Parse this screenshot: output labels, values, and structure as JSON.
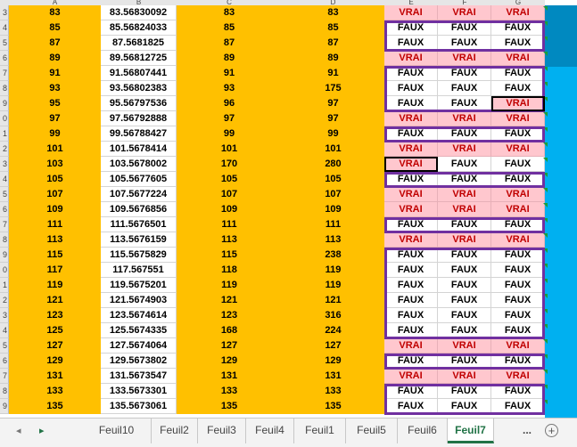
{
  "columns": [
    "A",
    "B",
    "C",
    "D",
    "E",
    "F",
    "G"
  ],
  "rows": [
    {
      "num": "3",
      "a": "83",
      "b": "83.56830092",
      "c": "83",
      "d": "83",
      "e": "VRAI",
      "f": "VRAI",
      "g": "VRAI"
    },
    {
      "num": "4",
      "a": "85",
      "b": "85.56824033",
      "c": "85",
      "d": "85",
      "e": "FAUX",
      "f": "FAUX",
      "g": "FAUX"
    },
    {
      "num": "5",
      "a": "87",
      "b": "87.5681825",
      "c": "87",
      "d": "87",
      "e": "FAUX",
      "f": "FAUX",
      "g": "FAUX"
    },
    {
      "num": "6",
      "a": "89",
      "b": "89.56812725",
      "c": "89",
      "d": "89",
      "e": "VRAI",
      "f": "VRAI",
      "g": "VRAI"
    },
    {
      "num": "7",
      "a": "91",
      "b": "91.56807441",
      "c": "91",
      "d": "91",
      "e": "FAUX",
      "f": "FAUX",
      "g": "FAUX"
    },
    {
      "num": "8",
      "a": "93",
      "b": "93.56802383",
      "c": "93",
      "d": "175",
      "e": "FAUX",
      "f": "FAUX",
      "g": "FAUX"
    },
    {
      "num": "9",
      "a": "95",
      "b": "95.56797536",
      "c": "96",
      "d": "97",
      "e": "FAUX",
      "f": "FAUX",
      "g": "VRAI"
    },
    {
      "num": "0",
      "a": "97",
      "b": "97.56792888",
      "c": "97",
      "d": "97",
      "e": "VRAI",
      "f": "VRAI",
      "g": "VRAI"
    },
    {
      "num": "1",
      "a": "99",
      "b": "99.56788427",
      "c": "99",
      "d": "99",
      "e": "FAUX",
      "f": "FAUX",
      "g": "FAUX"
    },
    {
      "num": "2",
      "a": "101",
      "b": "101.5678414",
      "c": "101",
      "d": "101",
      "e": "VRAI",
      "f": "VRAI",
      "g": "VRAI"
    },
    {
      "num": "3",
      "a": "103",
      "b": "103.5678002",
      "c": "170",
      "d": "280",
      "e": "VRAI",
      "f": "FAUX",
      "g": "FAUX"
    },
    {
      "num": "4",
      "a": "105",
      "b": "105.5677605",
      "c": "105",
      "d": "105",
      "e": "FAUX",
      "f": "FAUX",
      "g": "FAUX"
    },
    {
      "num": "5",
      "a": "107",
      "b": "107.5677224",
      "c": "107",
      "d": "107",
      "e": "VRAI",
      "f": "VRAI",
      "g": "VRAI"
    },
    {
      "num": "6",
      "a": "109",
      "b": "109.5676856",
      "c": "109",
      "d": "109",
      "e": "VRAI",
      "f": "VRAI",
      "g": "VRAI"
    },
    {
      "num": "7",
      "a": "111",
      "b": "111.5676501",
      "c": "111",
      "d": "111",
      "e": "FAUX",
      "f": "FAUX",
      "g": "FAUX"
    },
    {
      "num": "8",
      "a": "113",
      "b": "113.5676159",
      "c": "113",
      "d": "113",
      "e": "VRAI",
      "f": "VRAI",
      "g": "VRAI"
    },
    {
      "num": "9",
      "a": "115",
      "b": "115.5675829",
      "c": "115",
      "d": "238",
      "e": "FAUX",
      "f": "FAUX",
      "g": "FAUX"
    },
    {
      "num": "0",
      "a": "117",
      "b": "117.567551",
      "c": "118",
      "d": "119",
      "e": "FAUX",
      "f": "FAUX",
      "g": "FAUX"
    },
    {
      "num": "1",
      "a": "119",
      "b": "119.5675201",
      "c": "119",
      "d": "119",
      "e": "FAUX",
      "f": "FAUX",
      "g": "FAUX"
    },
    {
      "num": "2",
      "a": "121",
      "b": "121.5674903",
      "c": "121",
      "d": "121",
      "e": "FAUX",
      "f": "FAUX",
      "g": "FAUX"
    },
    {
      "num": "3",
      "a": "123",
      "b": "123.5674614",
      "c": "123",
      "d": "316",
      "e": "FAUX",
      "f": "FAUX",
      "g": "FAUX"
    },
    {
      "num": "4",
      "a": "125",
      "b": "125.5674335",
      "c": "168",
      "d": "224",
      "e": "FAUX",
      "f": "FAUX",
      "g": "FAUX"
    },
    {
      "num": "5",
      "a": "127",
      "b": "127.5674064",
      "c": "127",
      "d": "127",
      "e": "VRAI",
      "f": "VRAI",
      "g": "VRAI"
    },
    {
      "num": "6",
      "a": "129",
      "b": "129.5673802",
      "c": "129",
      "d": "129",
      "e": "FAUX",
      "f": "FAUX",
      "g": "FAUX"
    },
    {
      "num": "7",
      "a": "131",
      "b": "131.5673547",
      "c": "131",
      "d": "131",
      "e": "VRAI",
      "f": "VRAI",
      "g": "VRAI"
    },
    {
      "num": "8",
      "a": "133",
      "b": "133.5673301",
      "c": "133",
      "d": "133",
      "e": "FAUX",
      "f": "FAUX",
      "g": "FAUX"
    },
    {
      "num": "9",
      "a": "135",
      "b": "135.5673061",
      "c": "135",
      "d": "135",
      "e": "FAUX",
      "f": "FAUX",
      "g": "FAUX"
    }
  ],
  "tabs": [
    "Feuil10",
    "Feuil2",
    "Feuil3",
    "Feuil4",
    "Feuil1",
    "Feuil5",
    "Feuil6",
    "Feuil7"
  ],
  "active_tab": "Feuil7",
  "tabs_more": "...",
  "add_sheet_icon": "+",
  "nav": {
    "prev_icon": "◂",
    "next_icon": "▸"
  },
  "colors": {
    "highlight": "#ffc000",
    "true_fill": "#ffc7ce",
    "true_text": "#c00000",
    "group_border": "#7030a0",
    "side_panel": "#00b0f0",
    "active_tab": "#217346"
  }
}
